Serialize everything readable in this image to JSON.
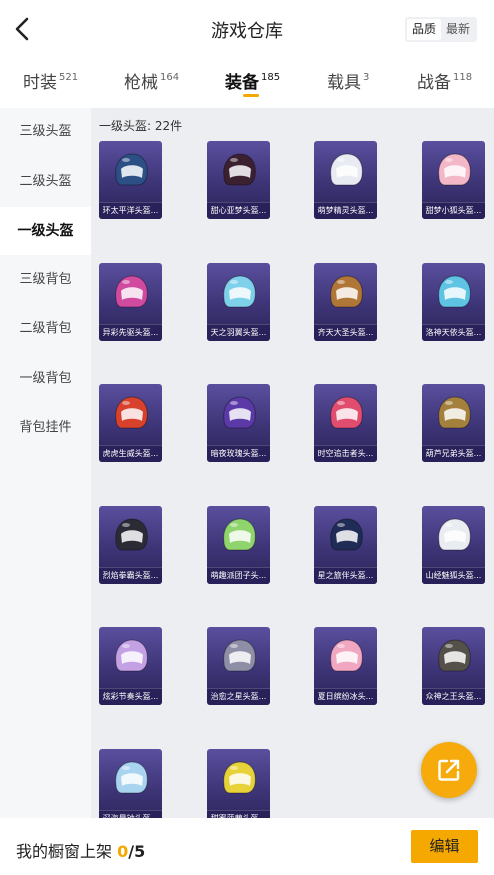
{
  "header": {
    "title": "游戏仓库",
    "sort_options": [
      "品质",
      "最新"
    ],
    "active_sort": 0
  },
  "tabs": [
    {
      "label": "时装",
      "count": "521"
    },
    {
      "label": "枪械",
      "count": "164"
    },
    {
      "label": "装备",
      "count": "185"
    },
    {
      "label": "载具",
      "count": "3"
    },
    {
      "label": "战备",
      "count": "118"
    }
  ],
  "active_tab": 2,
  "sidebar": {
    "items": [
      "三级头盔",
      "二级头盔",
      "一级头盔",
      "三级背包",
      "二级背包",
      "一级背包",
      "背包挂件"
    ],
    "active": 2
  },
  "section": {
    "title": "一级头盔: 22件"
  },
  "items": [
    {
      "name": "环太平洋头盔...",
      "color": "#2c4f86"
    },
    {
      "name": "甜心亚梦头盔...",
      "color": "#3b2030"
    },
    {
      "name": "萌梦精灵头盔...",
      "color": "#e8ecf2"
    },
    {
      "name": "甜梦小狐头盔...",
      "color": "#f3b7c7"
    },
    {
      "name": "异彩先驱头盔...",
      "color": "#d04aa0"
    },
    {
      "name": "天之羽翼头盔...",
      "color": "#7fd0ea"
    },
    {
      "name": "齐天大圣头盔...",
      "color": "#b07638"
    },
    {
      "name": "洛神天依头盔...",
      "color": "#5fc4e4"
    },
    {
      "name": "虎虎生威头盔...",
      "color": "#d8412b"
    },
    {
      "name": "暗夜玫瑰头盔...",
      "color": "#5b3aa8"
    },
    {
      "name": "时空追击者头...",
      "color": "#e04d6e"
    },
    {
      "name": "葫芦兄弟头盔...",
      "color": "#a3803c"
    },
    {
      "name": "烈焰拳霸头盔...",
      "color": "#2b2b35"
    },
    {
      "name": "萌趣派团子头...",
      "color": "#8fd46c"
    },
    {
      "name": "星之旅伴头盔...",
      "color": "#1f2c55"
    },
    {
      "name": "山经魅狐头盔...",
      "color": "#e9ecf0"
    },
    {
      "name": "炫彩节奏头盔...",
      "color": "#c4a0e4"
    },
    {
      "name": "治愈之星头盔...",
      "color": "#8e8ea6"
    },
    {
      "name": "夏日缤纷冰头...",
      "color": "#f1a7c2"
    },
    {
      "name": "众神之王头盔...",
      "color": "#55504a"
    },
    {
      "name": "深海晨钟头盔...",
      "color": "#a9d4f0"
    },
    {
      "name": "甜蜜菠萝头盔...",
      "color": "#e8d23a"
    }
  ],
  "footer": {
    "showcase_label": "我的橱窗上架",
    "current": "0",
    "separator": "/",
    "max": "5",
    "edit_label": "编辑"
  },
  "colors": {
    "accent": "#f5a800",
    "card_bg": "#3d3476"
  },
  "icons": {
    "back": "chevron-left-icon",
    "share": "share-external-icon"
  }
}
